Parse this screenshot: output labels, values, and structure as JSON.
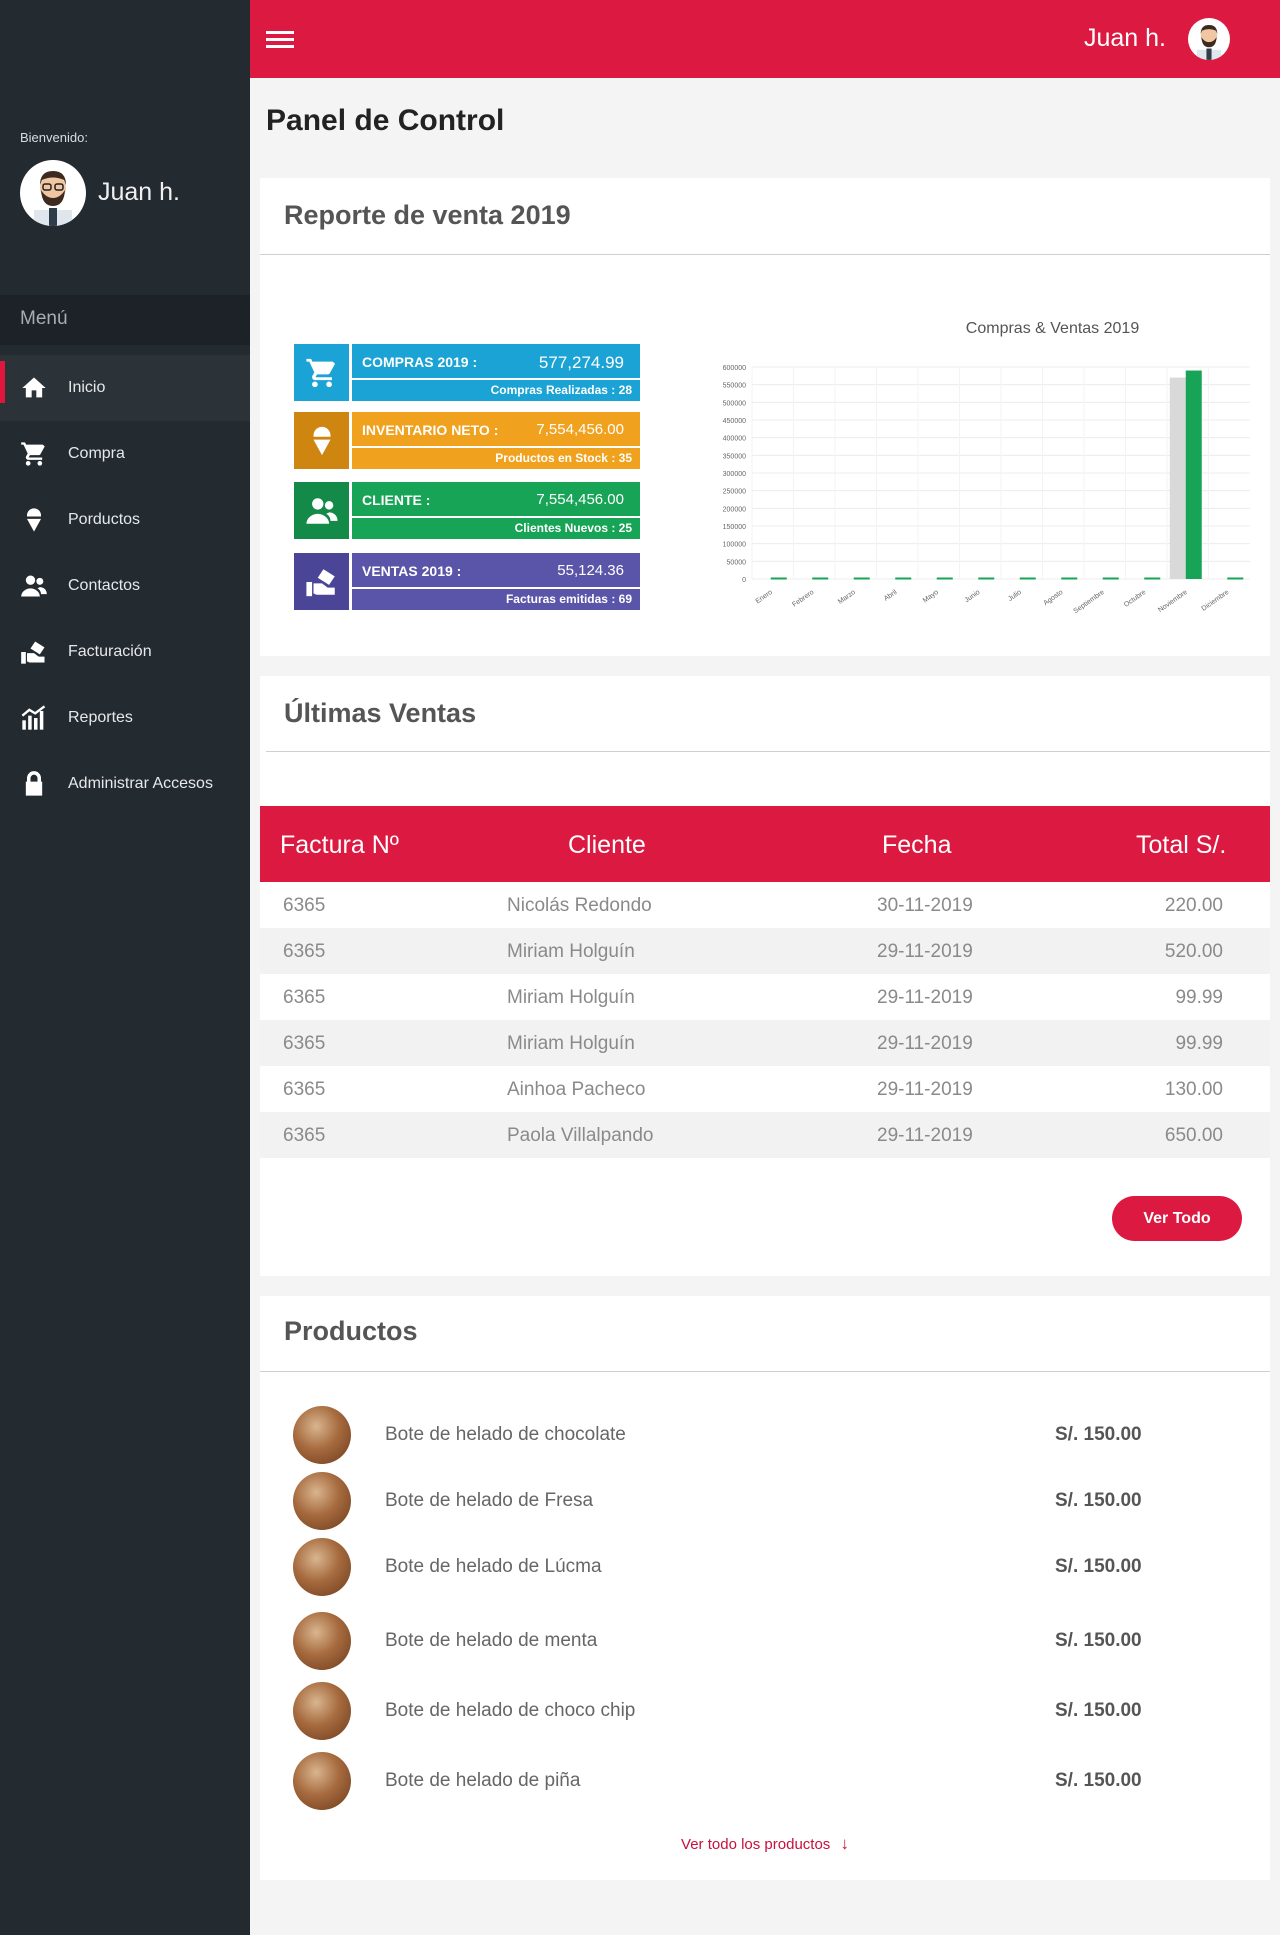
{
  "topbar": {
    "username": "Juan h."
  },
  "sidebar": {
    "welcome": "Bienvenido:",
    "username": "Juan h.",
    "menu_title": "Menú",
    "items": [
      {
        "label": "Inicio",
        "icon": "home-icon"
      },
      {
        "label": "Compra",
        "icon": "cart-icon"
      },
      {
        "label": "Porductos",
        "icon": "icecream-icon"
      },
      {
        "label": "Contactos",
        "icon": "contacts-icon"
      },
      {
        "label": "Facturación",
        "icon": "invoice-icon"
      },
      {
        "label": "Reportes",
        "icon": "reports-icon"
      },
      {
        "label": "Administrar Accesos",
        "icon": "lock-icon"
      }
    ]
  },
  "page": {
    "title": "Panel de Control"
  },
  "report": {
    "title": "Reporte de venta 2019",
    "tiles": [
      {
        "label": "COMPRAS 2019 :",
        "value": "577,274.99",
        "sub": "Compras Realizadas : 28",
        "color": "#1aa3d4",
        "icon": "cart-icon"
      },
      {
        "label": "INVENTARIO NETO :",
        "value": "7,554,456.00",
        "sub": "Productos en Stock : 35",
        "color": "#f0a11d",
        "icon": "icecream-icon"
      },
      {
        "label": "CLIENTE :",
        "value": "7,554,456.00",
        "sub": "Clientes Nuevos : 25",
        "color": "#17a456",
        "icon": "contacts-icon"
      },
      {
        "label": "VENTAS 2019 :",
        "value": "55,124.36",
        "sub": "Facturas emitidas : 69",
        "color": "#5a55a8",
        "icon": "invoice-icon"
      }
    ]
  },
  "chart_data": {
    "type": "bar",
    "title": "Compras & Ventas 2019",
    "categories": [
      "Enero",
      "Febrero",
      "Marzo",
      "Abril",
      "Mayo",
      "Junio",
      "Julio",
      "Agosto",
      "Septiembre",
      "Octubre",
      "Noviembre",
      "Diciembre"
    ],
    "series": [
      {
        "values": [
          0,
          0,
          0,
          0,
          0,
          0,
          0,
          0,
          0,
          0,
          570000,
          0
        ],
        "color": "#d9d9d9"
      },
      {
        "values": [
          0,
          0,
          0,
          0,
          0,
          0,
          0,
          0,
          0,
          0,
          590000,
          0
        ],
        "color": "#17a456"
      }
    ],
    "yticks": [
      "600000",
      "550000",
      "500000",
      "450000",
      "400000",
      "350000",
      "300000",
      "250000",
      "200000",
      "150000",
      "100000",
      "50000",
      "0"
    ],
    "ylim": [
      0,
      600000
    ],
    "grid": true
  },
  "sales": {
    "title": "Últimas Ventas",
    "headers": [
      "Factura Nº",
      "Cliente",
      "Fecha",
      "Total S/."
    ],
    "rows": [
      {
        "factura": "6365",
        "cliente": "Nicolás Redondo",
        "fecha": "30-11-2019",
        "total": "220.00"
      },
      {
        "factura": "6365",
        "cliente": "Miriam Holguín",
        "fecha": "29-11-2019",
        "total": "520.00"
      },
      {
        "factura": "6365",
        "cliente": "Miriam Holguín",
        "fecha": "29-11-2019",
        "total": "99.99"
      },
      {
        "factura": "6365",
        "cliente": "Miriam Holguín",
        "fecha": "29-11-2019",
        "total": "99.99"
      },
      {
        "factura": "6365",
        "cliente": "Ainhoa Pacheco",
        "fecha": "29-11-2019",
        "total": "130.00"
      },
      {
        "factura": "6365",
        "cliente": "Paola Villalpando",
        "fecha": "29-11-2019",
        "total": "650.00"
      }
    ],
    "button": "Ver Todo"
  },
  "products": {
    "title": "Productos",
    "items": [
      {
        "name": "Bote de helado de chocolate",
        "price": "S/. 150.00"
      },
      {
        "name": "Bote de helado de Fresa",
        "price": "S/. 150.00"
      },
      {
        "name": "Bote de helado de Lúcma",
        "price": "S/. 150.00"
      },
      {
        "name": "Bote de helado de menta",
        "price": "S/. 150.00"
      },
      {
        "name": "Bote de helado de choco chip",
        "price": "S/. 150.00"
      },
      {
        "name": "Bote de helado de piña",
        "price": "S/. 150.00"
      }
    ],
    "view_all": "Ver todo los productos"
  },
  "colors": {
    "brand": "#dc1a41",
    "sidebar": "#232a30"
  }
}
